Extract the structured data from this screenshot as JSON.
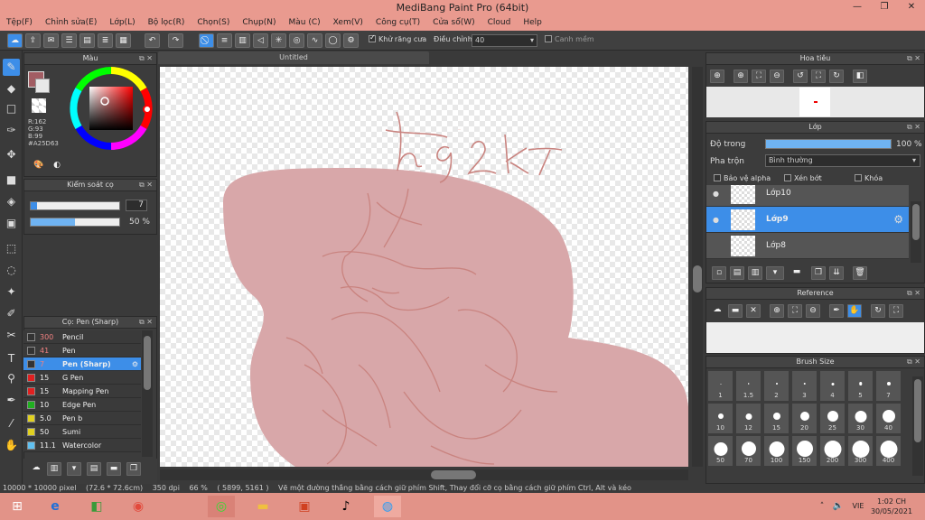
{
  "window": {
    "title": "MediBang Paint Pro (64bit)",
    "minimize": "—",
    "restore": "❐",
    "close": "✕"
  },
  "menu": [
    "Tệp(F)",
    "Chỉnh sửa(E)",
    "Lớp(L)",
    "Bộ lọc(R)",
    "Chọn(S)",
    "Chụp(N)",
    "Màu (C)",
    "Xem(V)",
    "Công cụ(T)",
    "Cửa sổ(W)",
    "Cloud",
    "Help"
  ],
  "toolbar": {
    "antialias_label": "Khử răng cưa",
    "correction_label": "Điều chỉnh",
    "correction_value": "40",
    "canh_mem_label": "Canh mềm"
  },
  "document": {
    "tab_title": "Untitled",
    "signature": "hg2k7"
  },
  "color_panel": {
    "title": "Màu",
    "primary": "#A25D63",
    "r": "R:162",
    "g": "G:93",
    "b": "B:99",
    "hex": "#A25D63"
  },
  "brush_control": {
    "title": "Kiểm soát cọ",
    "size_value": "7",
    "size_fraction": 0.07,
    "opacity_value": "50 %",
    "opacity_fraction": 0.5
  },
  "brush_panel": {
    "title": "Cọ: Pen (Sharp)",
    "items": [
      {
        "size": "300",
        "name": "Pencil",
        "color": "#333333"
      },
      {
        "size": "41",
        "name": "Pen",
        "color": "#333333"
      },
      {
        "size": "7",
        "name": "Pen (Sharp)",
        "color": "#333333"
      },
      {
        "size": "15",
        "name": "G Pen",
        "color": "#e02020"
      },
      {
        "size": "15",
        "name": "Mapping Pen",
        "color": "#e02020"
      },
      {
        "size": "10",
        "name": "Edge Pen",
        "color": "#20b020"
      },
      {
        "size": "5.0",
        "name": "Pen b",
        "color": "#e0d020"
      },
      {
        "size": "50",
        "name": "Sumi",
        "color": "#e0d020"
      },
      {
        "size": "11.1",
        "name": "Watercolor",
        "color": "#60c0f0"
      }
    ]
  },
  "navigator": {
    "title": "Hoa tiêu"
  },
  "layer_panel": {
    "title": "Lớp",
    "opacity_label": "Độ trong",
    "opacity_value": "100 %",
    "opacity_fraction": 1.0,
    "blend_label": "Pha trộn",
    "blend_value": "Bình thường",
    "protect_alpha": "Bảo vệ alpha",
    "clipping": "Xén bớt",
    "lock": "Khóa",
    "layers": [
      {
        "name": "Lớp10"
      },
      {
        "name": "Lớp9"
      },
      {
        "name": "Lớp8"
      }
    ]
  },
  "reference_panel": {
    "title": "Reference"
  },
  "brush_size_panel": {
    "title": "Brush Size",
    "sizes": [
      "1",
      "1.5",
      "2",
      "3",
      "4",
      "5",
      "7",
      "10",
      "12",
      "15",
      "20",
      "25",
      "30",
      "40",
      "50",
      "70",
      "100",
      "150",
      "200",
      "300",
      "400"
    ]
  },
  "status": {
    "size": "10000 * 10000 pixel",
    "cm": "(72.6 * 72.6cm)",
    "dpi": "350 dpi",
    "zoom": "66 %",
    "coords": "( 5899, 5161 )",
    "hint": "Vẽ một đường thẳng bằng cách giữ phím Shift, Thay đổi cỡ cọ bằng cách giữ phím Ctrl, Alt và kéo"
  },
  "taskbar": {
    "lang": "VIE",
    "time": "1:02 CH",
    "date": "30/05/2021"
  },
  "colors": {
    "titlebar": "#e99a8f",
    "accent": "#3d8ee8",
    "shape_fill": "#d8a7a9",
    "stroke": "#c9837f"
  }
}
